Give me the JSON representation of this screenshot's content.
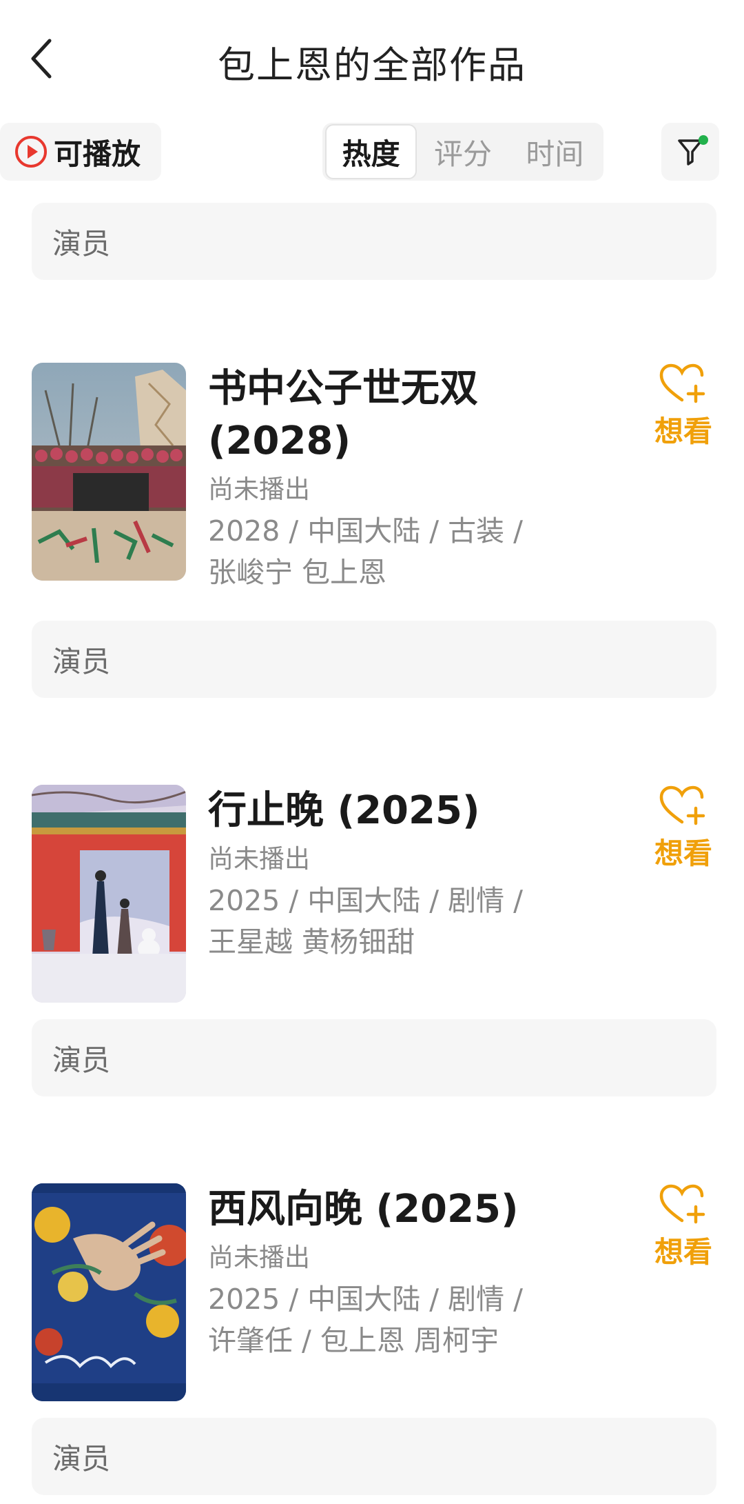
{
  "header": {
    "title": "包上恩的全部作品",
    "back_icon": "chevron-left-icon"
  },
  "toolbar": {
    "playable_label": "可播放",
    "play_icon": "play-circle-icon",
    "sort_tabs": [
      {
        "label": "热度",
        "active": true
      },
      {
        "label": "评分",
        "active": false
      },
      {
        "label": "时间",
        "active": false
      }
    ],
    "filter_icon": "filter-icon"
  },
  "role_label": "演员",
  "wish_label": "想看",
  "films": [
    {
      "title": "书中公子世无双",
      "year": "(2028)",
      "status": "尚未播出",
      "meta": "2028 / 中国大陆 / 古装 /",
      "cast": "张峻宁 包上恩"
    },
    {
      "title": "行止晚",
      "year": "(2025)",
      "status": "尚未播出",
      "meta": "2025 / 中国大陆 / 剧情 /",
      "cast": "王星越 黄杨钿甜"
    },
    {
      "title": "西风向晚",
      "year": "(2025)",
      "status": "尚未播出",
      "meta": "2025 / 中国大陆 / 剧情 /",
      "cast": "许肇任 / 包上恩 周柯宇"
    }
  ],
  "colors": {
    "accent_orange": "#f0a00a",
    "play_red": "#e8382e",
    "filter_dot_green": "#22b14c"
  }
}
